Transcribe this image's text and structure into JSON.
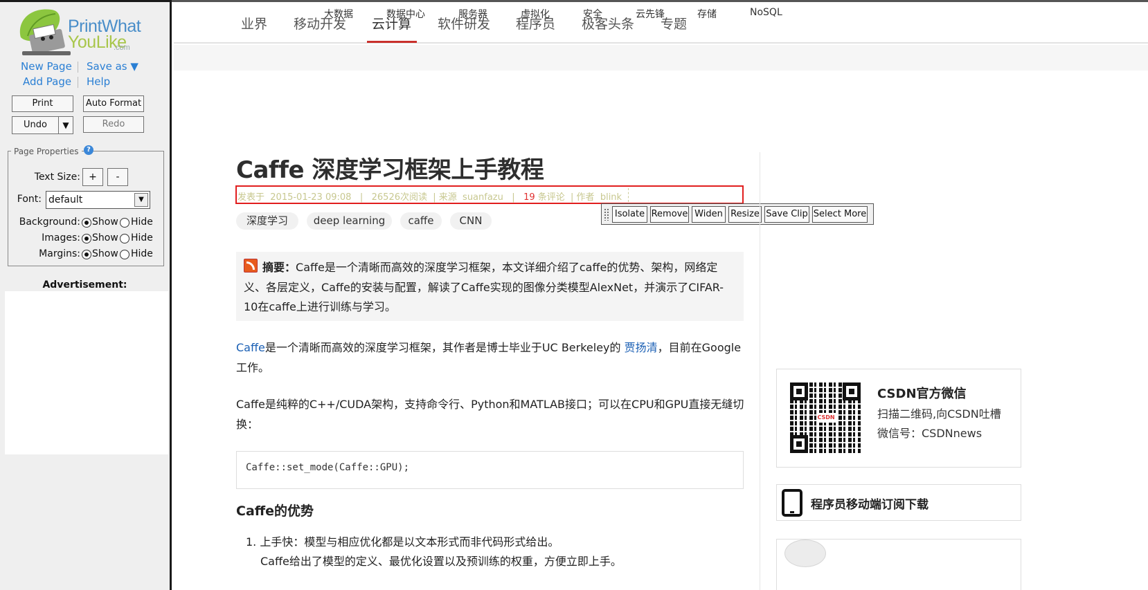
{
  "sidebar": {
    "logo_word1": "PrintWhat",
    "logo_word2": "YouLike",
    "logo_com": ".com",
    "links": {
      "new_page": "New Page",
      "save_as": "Save as ▼",
      "add_page": "Add Page",
      "help": "Help"
    },
    "buttons": {
      "print": "Print",
      "auto_format": "Auto Format",
      "undo": "Undo",
      "undo_dropdown": "▼",
      "redo": "Redo"
    },
    "page_properties": {
      "legend": "Page Properties",
      "help_icon": "?",
      "text_size_label": "Text Size:",
      "plus": "+",
      "minus": "-",
      "font_label": "Font:",
      "font_value": "default",
      "font_arrow": "▼",
      "background_label": "Background:",
      "images_label": "Images:",
      "margins_label": "Margins:",
      "show": "Show",
      "hide": "Hide"
    },
    "ad_title": "Advertisement:"
  },
  "nav": {
    "primary": [
      "业界",
      "移动开发",
      "云计算",
      "软件研发",
      "程序员",
      "极客头条",
      "专题"
    ],
    "active": "云计算",
    "secondary": [
      "大数据",
      "数据中心",
      "服务器",
      "虚拟化",
      "安全",
      "云先锋",
      "存储",
      "NoSQL"
    ]
  },
  "article": {
    "title": "Caffe 深度学习框架上手教程",
    "meta": {
      "published_prefix": "发表于",
      "date": "2015-01-23 09:08",
      "sep1": "|",
      "reads": "26526次阅读",
      "source_prefix": "| 来源",
      "source": "suanfazu",
      "sep2": "|",
      "comments_count": "19",
      "comments_suffix": "条评论",
      "author_prefix": "| 作者",
      "author": "blink"
    },
    "tags": [
      "深度学习",
      "deep learning",
      "caffe",
      "CNN"
    ],
    "summary_label": "摘要：",
    "summary": "Caffe是一个清晰而高效的深度学习框架，本文详细介绍了caffe的优势、架构，网络定义、各层定义，Caffe的安装与配置，解读了Caffe实现的图像分类模型AlexNet，并演示了CIFAR-10在caffe上进行训练与学习。",
    "para1_link": "Caffe",
    "para1_mid": "是一个清晰而高效的深度学习框架，其作者是博士毕业于UC Berkeley的 ",
    "para1_link2": "贾扬清",
    "para1_end": "，目前在Google工作。",
    "para2": "Caffe是纯粹的C++/CUDA架构，支持命令行、Python和MATLAB接口；可以在CPU和GPU直接无缝切换：",
    "code": "Caffe::set_mode(Caffe::GPU);",
    "heading": "Caffe的优势",
    "list1": "1.  上手快：模型与相应优化都是以文本形式而非代码形式给出。",
    "list2": "Caffe给出了模型的定义、最优化设置以及预训练的权重，方便立即上手。"
  },
  "clip_toolbar": [
    "Isolate",
    "Remove",
    "Widen",
    "Resize",
    "Save Clip",
    "Select More"
  ],
  "right": {
    "wechat_title": "CSDN官方微信",
    "wechat_line1": "扫描二维码,向CSDN吐槽",
    "wechat_line2": "微信号：CSDNnews",
    "qr_logo": "CSDN",
    "app_text": "程序员移动端订阅下载"
  },
  "colors": {
    "accent_red": "#c9302c",
    "link_blue": "#1a5fb4",
    "logo_blue": "#4a8ec9",
    "logo_green": "#a8c64a",
    "selection_border": "#e11e1e"
  },
  "icons": [
    "logo-leaf-printer-icon",
    "help-icon",
    "rss-icon",
    "qr-code-icon",
    "phone-icon",
    "grip-icon"
  ]
}
